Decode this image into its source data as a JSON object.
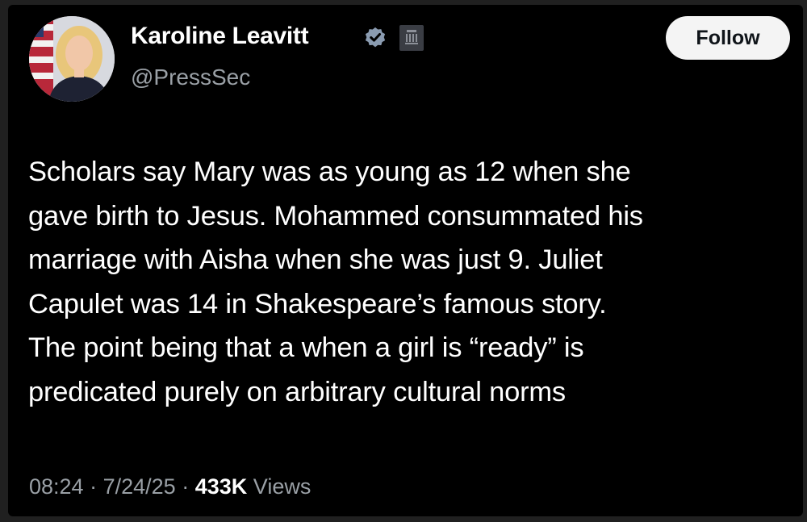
{
  "tweet": {
    "author": {
      "name": "Karoline Leavitt",
      "handle": "@PressSec",
      "verified_icon": "verified-badge-icon",
      "affiliate_icon": "government-affiliate-badge-icon"
    },
    "follow_label": "Follow",
    "text_lines": [
      "Scholars say Mary was as young as 12 when she",
      "gave birth to Jesus. Mohammed consummated his",
      "marriage with Aisha when she was just 9. Juliet",
      "Capulet was 14 in Shakespeare’s famous story.",
      "The point being that a when a girl is “ready” is",
      "predicated purely on arbitrary cultural norms"
    ],
    "time": "08:24",
    "separator": "·",
    "date": "7/24/25",
    "views_count": "433K",
    "views_label": "Views"
  },
  "colors": {
    "background": "#000000",
    "text": "#ffffff",
    "secondary_text": "#9aa0a6",
    "verified_badge": "#8a9bb0",
    "follow_button_bg": "#f4f4f4"
  }
}
